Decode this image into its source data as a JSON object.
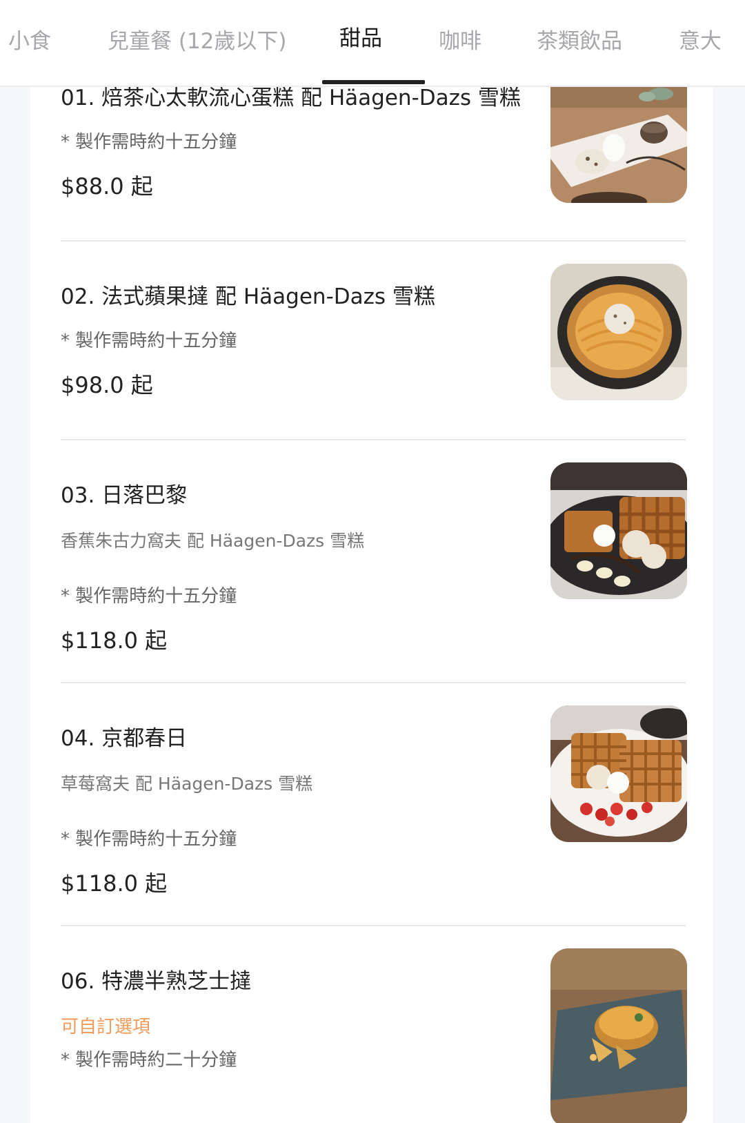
{
  "tabs": [
    {
      "label": "小食"
    },
    {
      "label": "兒童餐 (12歲以下)"
    },
    {
      "label": "甜品"
    },
    {
      "label": "咖啡"
    },
    {
      "label": "茶類飲品"
    },
    {
      "label": "意大"
    }
  ],
  "active_tab": "甜品",
  "items": [
    {
      "name": "01. 焙茶心太軟流心蛋糕 配 Häagen-Dazs 雪糕",
      "note": "* 製作需時約十五分鐘",
      "price": "$88.0 起",
      "image": "lava-cake-photo"
    },
    {
      "name": "02. 法式蘋果撻 配 Häagen-Dazs 雪糕",
      "note": "* 製作需時約十五分鐘",
      "price": "$98.0 起",
      "image": "apple-tart-photo"
    },
    {
      "name": "03. 日落巴黎",
      "desc": "香蕉朱古力窩夫 配 Häagen-Dazs 雪糕",
      "note": "* 製作需時約十五分鐘",
      "price": "$118.0 起",
      "image": "banana-waffle-photo"
    },
    {
      "name": "04. 京都春日",
      "desc": "草莓窩夫 配 Häagen-Dazs 雪糕",
      "note": " * 製作需時約十五分鐘",
      "price": "$118.0 起",
      "image": "strawberry-waffle-photo"
    },
    {
      "name": "06. 特濃半熟芝士撻",
      "option": "可自訂選項",
      "note": "* 製作需時約二十分鐘",
      "image": "cheese-tart-photo"
    }
  ],
  "colors": {
    "active_tab": "#1b1b1b",
    "inactive_tab": "#a6a6ab",
    "option_text": "#f19a5b",
    "page_bg": "#f6f7fa"
  }
}
